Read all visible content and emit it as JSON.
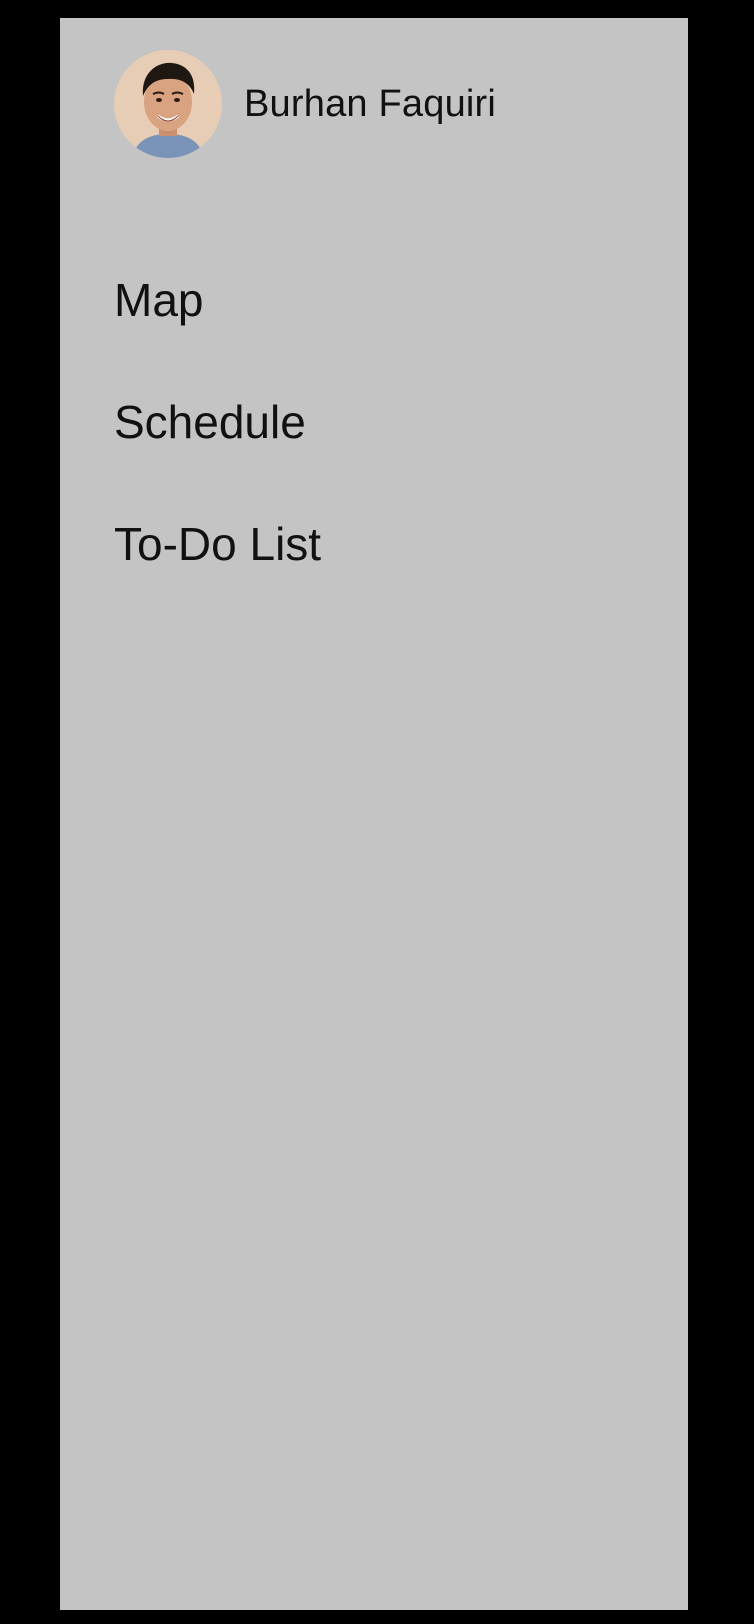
{
  "user": {
    "name": "Burhan Faquiri",
    "avatar": "user-avatar-photo"
  },
  "menu": {
    "items": [
      {
        "label": "Map"
      },
      {
        "label": "Schedule"
      },
      {
        "label": "To-Do List"
      }
    ]
  },
  "colors": {
    "background": "#000000",
    "drawer": "#c4c4c4",
    "text": "#111111"
  }
}
